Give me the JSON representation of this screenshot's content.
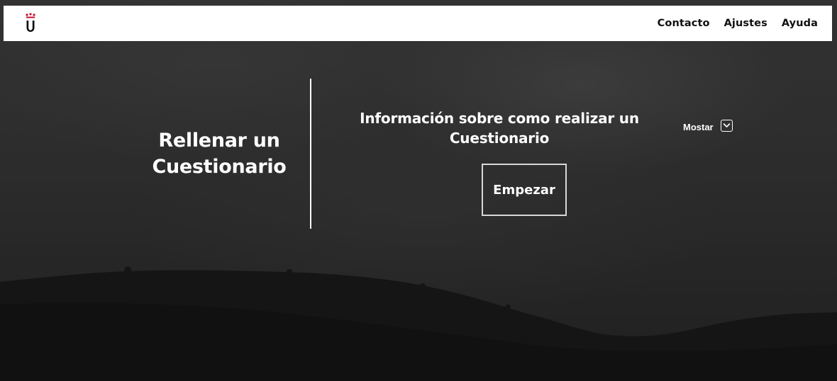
{
  "navbar": {
    "logo_icon": "university-logo-icon",
    "links": [
      {
        "label": "Contacto"
      },
      {
        "label": "Ajustes"
      },
      {
        "label": "Ayuda"
      }
    ]
  },
  "hero": {
    "title_line1": "Rellenar un",
    "title_line2": "Cuestionario",
    "info_line1": "Información sobre como realizar un",
    "info_line2": "Cuestionario",
    "start_button": "Empezar",
    "show_toggle": {
      "label": "Mostar",
      "icon": "chevron-down-icon"
    }
  },
  "colors": {
    "navbar_bg": "#ffffff",
    "nav_text": "#111111",
    "hero_text": "#ffffff",
    "logo_red": "#c8102e",
    "background": "#2a2a2a"
  }
}
